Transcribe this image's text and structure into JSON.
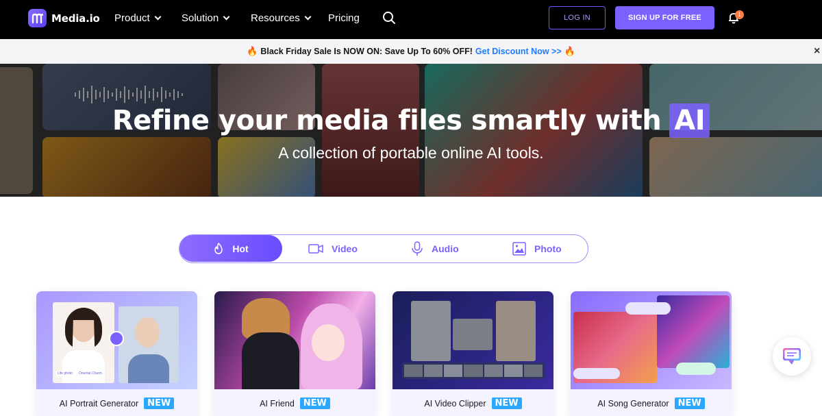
{
  "header": {
    "logo_text": "Media.io",
    "nav": [
      {
        "label": "Product"
      },
      {
        "label": "Solution"
      },
      {
        "label": "Resources"
      },
      {
        "label": "Pricing"
      }
    ],
    "login_label": "LOG IN",
    "signup_label": "SIGN UP FOR FREE",
    "notification_count": "1"
  },
  "promo": {
    "text": "Black Friday Sale Is NOW ON: Save Up To 60% OFF!",
    "link": "Get Discount Now >>"
  },
  "hero": {
    "title": "Refine your media files smartly with",
    "title_highlight": "AI",
    "subtitle": "A collection of portable online AI tools."
  },
  "tabs": [
    {
      "label": "Hot",
      "active": true
    },
    {
      "label": "Video"
    },
    {
      "label": "Audio"
    },
    {
      "label": "Photo"
    }
  ],
  "cards": [
    {
      "title": "AI Portrait Generator",
      "badge": "NEW",
      "tags": [
        "Life photo",
        "Oriental Charm"
      ]
    },
    {
      "title": "AI Friend",
      "badge": "NEW"
    },
    {
      "title": "AI Video Clipper",
      "badge": "NEW"
    },
    {
      "title": "AI Song Generator",
      "badge": "NEW"
    }
  ],
  "colors": {
    "brand": "#7b61ff",
    "nav_bg": "#000000",
    "promo_link": "#1f7bff",
    "new_badge": "#2aa7ff"
  }
}
